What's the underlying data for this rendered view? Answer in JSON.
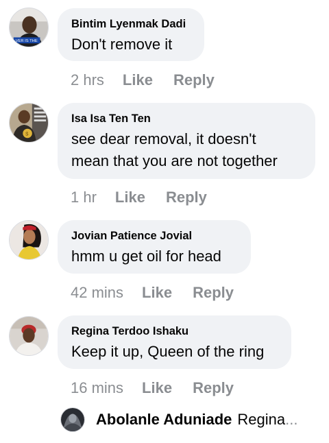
{
  "comments": [
    {
      "author": "Bintim Lyenmak Dadi",
      "text": "Don't remove it",
      "time": "2 hrs",
      "like": "Like",
      "reply": "Reply",
      "avatar_icon": "profile-photo-man-icon"
    },
    {
      "author": "Isa Isa Ten Ten",
      "text_lines": [
        "see dear removal, it doesn't",
        "mean that you are not together"
      ],
      "time": "1 hr",
      "like": "Like",
      "reply": "Reply",
      "avatar_icon": "profile-photo-man-icon"
    },
    {
      "author": "Jovian Patience Jovial",
      "text": "hmm u get oil for head",
      "time": "42 mins",
      "like": "Like",
      "reply": "Reply",
      "avatar_icon": "profile-photo-woman-icon"
    },
    {
      "author": "Regina Terdoo Ishaku",
      "text": "Keep it up, Queen of the ring",
      "time": "16 mins",
      "like": "Like",
      "reply": "Reply",
      "avatar_icon": "profile-photo-woman-icon"
    }
  ],
  "reply_preview": {
    "author": "Abolanle Aduniade",
    "snippet": "Regina",
    "ellipsis": "...",
    "avatar_icon": "profile-photo-icon"
  },
  "colors": {
    "bubble": "#f0f2f5",
    "meta_text": "#8a8d91",
    "text": "#050505"
  }
}
